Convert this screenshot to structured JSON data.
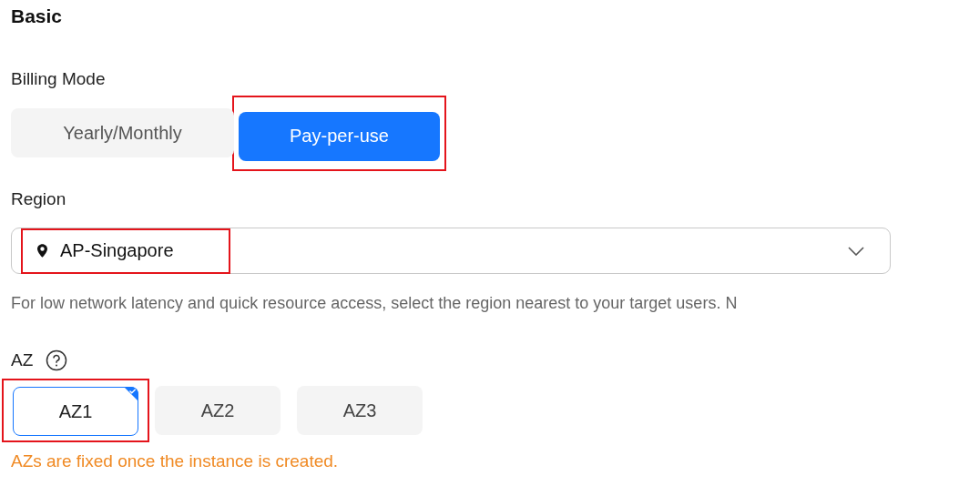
{
  "section_title": "Basic",
  "billing": {
    "label": "Billing Mode",
    "options": [
      {
        "label": "Yearly/Monthly",
        "selected": false,
        "highlighted": false
      },
      {
        "label": "Pay-per-use",
        "selected": true,
        "highlighted": true
      }
    ]
  },
  "region": {
    "label": "Region",
    "value": "AP-Singapore",
    "highlighted": true,
    "hint": "For low network latency and quick resource access, select the region nearest to your target users. N"
  },
  "az": {
    "label": "AZ",
    "options": [
      {
        "label": "AZ1",
        "selected": true,
        "highlighted": true
      },
      {
        "label": "AZ2",
        "selected": false,
        "highlighted": false
      },
      {
        "label": "AZ3",
        "selected": false,
        "highlighted": false
      }
    ],
    "warning": "AZs are fixed once the instance is created."
  }
}
